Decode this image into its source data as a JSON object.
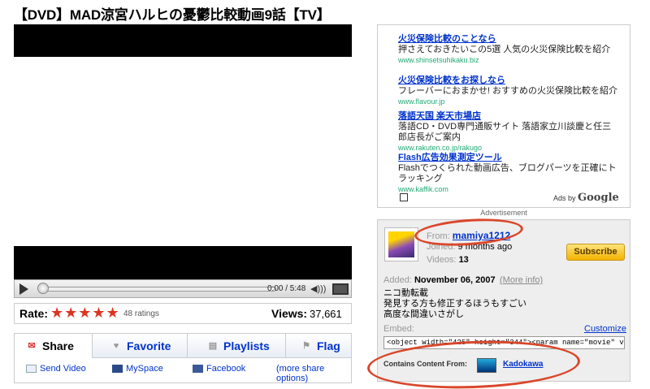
{
  "page_title": "【DVD】MAD涼宮ハルヒの憂鬱比較動画9話【TV】",
  "player": {
    "time": "0:00 / 5:48",
    "progress": 0.0
  },
  "rating": {
    "label": "Rate:",
    "stars": "★★★★★",
    "count": "48 ratings",
    "views_label": "Views:",
    "views": "37,661"
  },
  "actions": {
    "tabs": [
      "Share",
      "Favorite",
      "Playlists",
      "Flag"
    ],
    "share_links": [
      "Send Video",
      "MySpace",
      "Facebook",
      "(more share options)"
    ]
  },
  "ads": [
    {
      "title": "火災保険比較のことなら",
      "desc": "押さえておきたいこの5選 人気の火災保険比較を紹介",
      "url": "www.shinsetsuhikaku.biz"
    },
    {
      "title": "火災保険比較をお探しなら",
      "desc": "フレーバーにおまかせ! おすすめの火災保険比較を紹介",
      "url": "www.flavour.jp"
    },
    {
      "title": "落語天国 楽天市場店",
      "desc": "落語CD・DVD専門通販サイト 落語家立川談慶と任三郎店長がご案内",
      "url": "www.rakuten.co.jp/rakugo"
    },
    {
      "title": "Flash広告効果測定ツール",
      "desc": "Flashでつくられた動画広告、ブログパーツを正確にトラッキング",
      "url": "www.kaffik.com"
    }
  ],
  "ads_by": "Ads by",
  "ads_google": "Google",
  "ad_label": "Advertisement",
  "channel": {
    "from_label": "From:",
    "user": "mamiya1212",
    "joined_label": "Joined:",
    "joined": "9 months ago",
    "videos_label": "Videos:",
    "videos": "13",
    "subscribe": "Subscribe",
    "added_label": "Added:",
    "added": "November 06, 2007",
    "more_info": "(More info)",
    "desc_lines": [
      "ニコ動転載",
      "発見する方も修正するほうもすごい",
      "高度な間違いさがし"
    ],
    "embed_label": "Embed:",
    "customize": "Customize",
    "embed_code": "<object width=\"425\" height=\"344\"><param name=\"movie\" value=\"h",
    "content_label": "Contains Content From:",
    "content_owner": "Kadokawa"
  },
  "colors": {
    "link": "#0033cc",
    "annotation": "#d9472b",
    "subscribe": "#f2b300"
  }
}
